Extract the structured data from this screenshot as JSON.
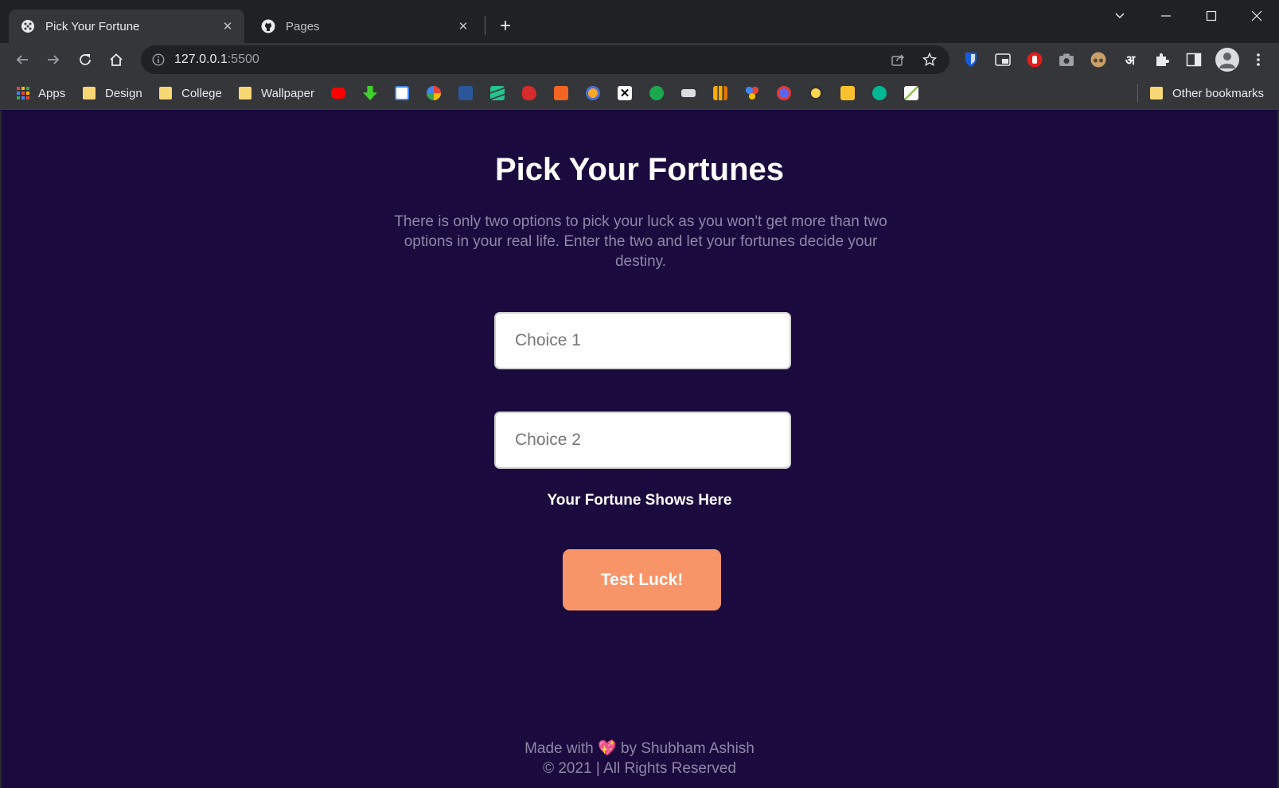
{
  "browser": {
    "tabs": [
      {
        "title": "Pick Your Fortune",
        "active": true
      },
      {
        "title": "Pages",
        "active": false
      }
    ],
    "address": {
      "host": "127.0.0.1",
      "port": ":5500"
    },
    "bookmarks": {
      "apps": "Apps",
      "folders": [
        "Design",
        "College",
        "Wallpaper"
      ],
      "other": "Other bookmarks"
    },
    "extensions": {
      "hindi_glyph": "अ"
    }
  },
  "page": {
    "title": "Pick Your Fortunes",
    "description": "There is only two options to pick your luck as you won't get more than two options in your real life. Enter the two and let your fortunes decide your destiny.",
    "choice1_placeholder": "Choice 1",
    "choice2_placeholder": "Choice 2",
    "fortune_text": "Your Fortune Shows Here",
    "button_label": "Test Luck!",
    "footer": {
      "made_with": "Made with",
      "heart": "💖",
      "by": "by Shubham Ashish",
      "copyright": "© 2021 | All Rights Reserved"
    }
  },
  "colors": {
    "background": "#1a0a3d",
    "button": "#f79468",
    "muted_text": "#8f86a8"
  }
}
